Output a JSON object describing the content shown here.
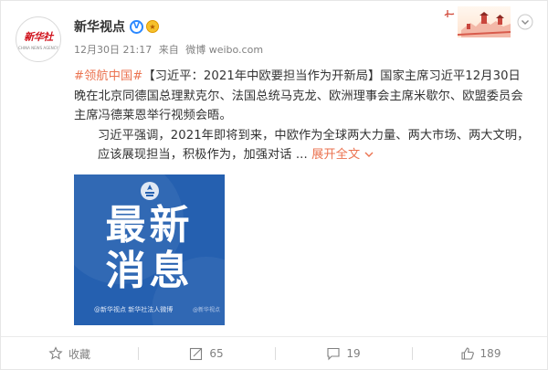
{
  "account": {
    "name": "新华视点",
    "avatar_text": "新华社",
    "avatar_sub": "CHINA NEWS AGENCY",
    "verified_icon": "v-verified-badge-icon",
    "medal_icon": "gold-medal-icon"
  },
  "meta": {
    "time": "12月30日 21:17",
    "source_prefix": "来自",
    "source": "微博 weibo.com"
  },
  "post": {
    "hashtag": "#领航中国#",
    "line1": "【习近平：2021年中欧要担当作为开新局】国家主席习近平12月30日晚在北京同德国总理默克尔、法国总统马克龙、欧洲理事会主席米歇尔、欧盟委员会主席冯德莱恩举行视频会晤。",
    "line2": "习近平强调，2021年即将到来，中欧作为全球两大力量、两大市场、两大文明，应该展现担当，积极作为，加强对话 ...",
    "expand_label": "展开全文",
    "expand_icon": "chevron-down-icon"
  },
  "image": {
    "title_line1": "最新",
    "title_line2": "消息",
    "credit": "@新华视点  新华社法人微博",
    "watermark": "@新华视点",
    "emblem_icon": "xinhua-emblem-icon"
  },
  "actions": [
    {
      "label": "收藏",
      "icon": "star-icon"
    },
    {
      "label": "65",
      "icon": "share-icon"
    },
    {
      "label": "19",
      "icon": "comment-icon"
    },
    {
      "label": "189",
      "icon": "thumbs-up-icon"
    }
  ],
  "colors": {
    "accent": "#eb7350",
    "verified": "#2b88ff",
    "poster_blue": "#2560b0"
  }
}
